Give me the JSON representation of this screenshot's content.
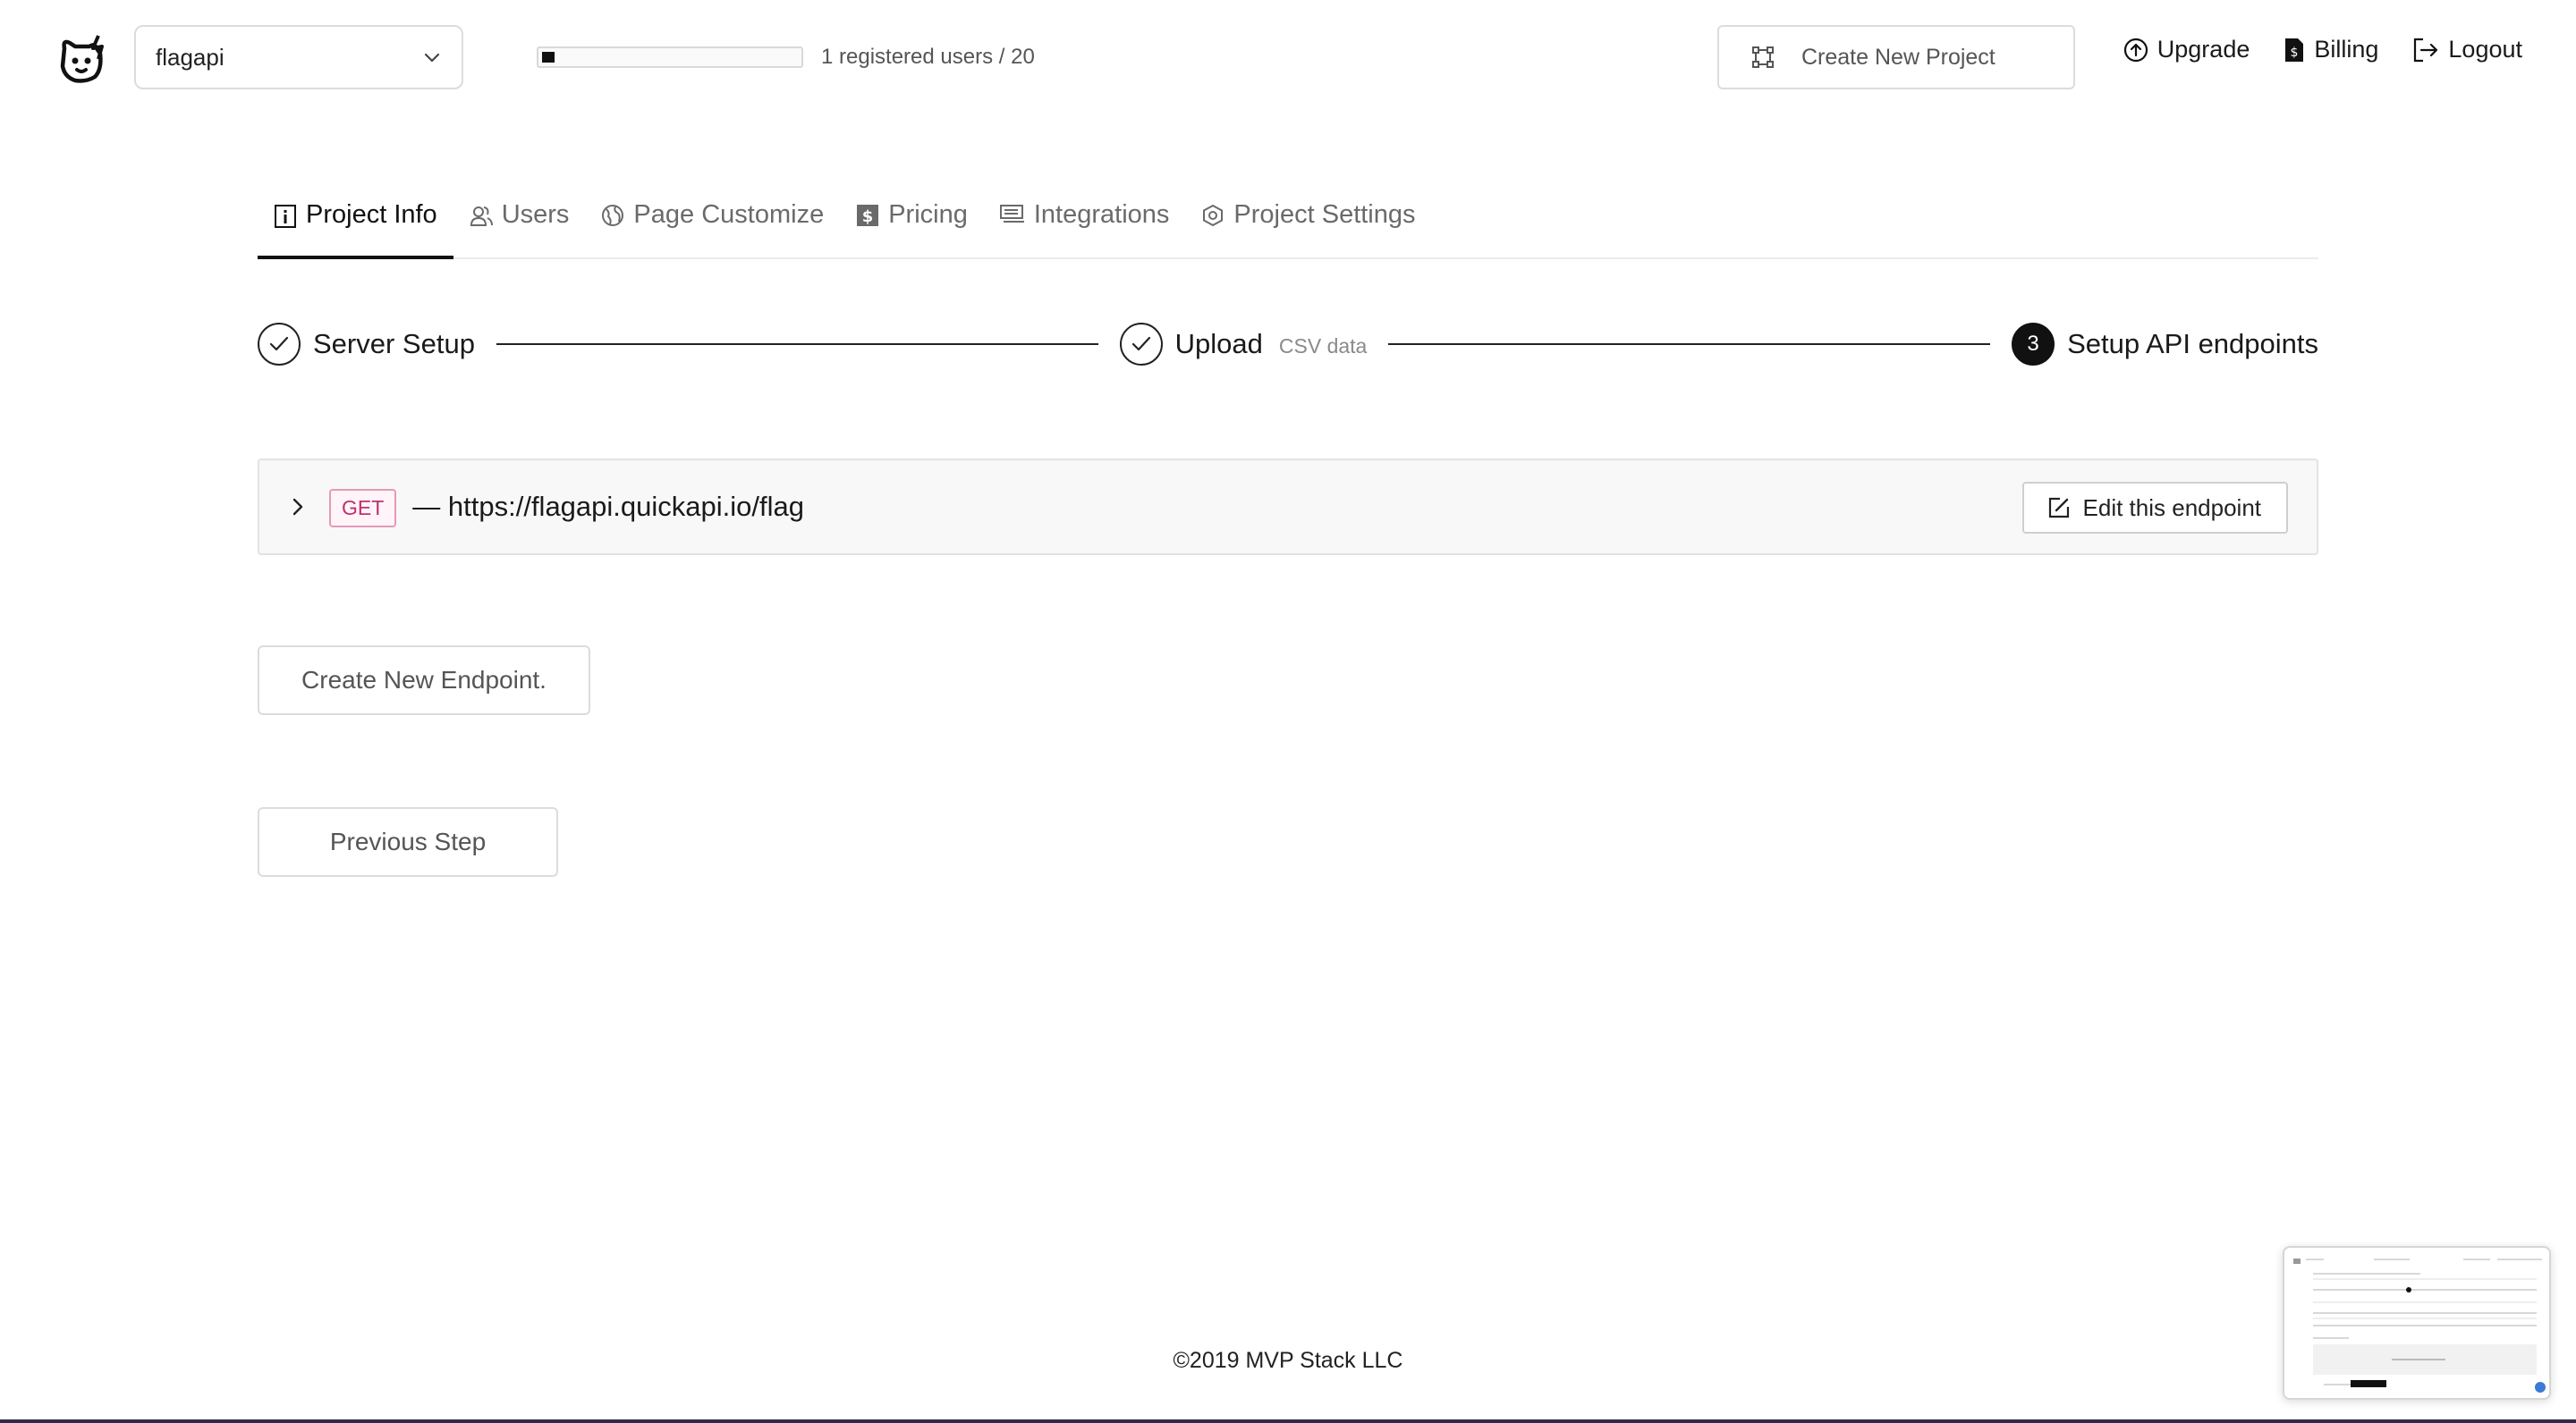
{
  "header": {
    "logo_icon": "dog-face-logo-icon",
    "project_select": {
      "value": "flagapi"
    },
    "usage": {
      "text": "1 registered users / 20",
      "fraction": 0.05
    },
    "create_project_label": "Create New Project",
    "links": [
      {
        "label": "Upgrade",
        "icon": "arrow-up-circle-icon"
      },
      {
        "label": "Billing",
        "icon": "dollar-document-icon"
      },
      {
        "label": "Logout",
        "icon": "logout-icon"
      }
    ]
  },
  "tabs": [
    {
      "label": "Project Info",
      "icon": "info-icon",
      "active": true
    },
    {
      "label": "Users",
      "icon": "users-icon",
      "active": false
    },
    {
      "label": "Page Customize",
      "icon": "globe-icon",
      "active": false
    },
    {
      "label": "Pricing",
      "icon": "dollar-icon",
      "active": false
    },
    {
      "label": "Integrations",
      "icon": "integrations-icon",
      "active": false
    },
    {
      "label": "Project Settings",
      "icon": "settings-hexagon-icon",
      "active": false
    }
  ],
  "stepper": {
    "steps": [
      {
        "title": "Server Setup",
        "desc": "",
        "state": "done"
      },
      {
        "title": "Upload",
        "desc": "CSV data",
        "state": "done"
      },
      {
        "title": "Setup API endpoints",
        "desc": "",
        "state": "current",
        "number": "3"
      }
    ]
  },
  "endpoint": {
    "method": "GET",
    "url": "— https://flagapi.quickapi.io/flag",
    "edit_label": "Edit this endpoint"
  },
  "actions": {
    "create_endpoint": "Create New Endpoint.",
    "previous_step": "Previous Step"
  },
  "footer": {
    "copyright": "©2019 MVP Stack LLC"
  },
  "colors": {
    "accent": "#111111",
    "method_badge": "#c0306f",
    "endpoint_bg": "#f8f8f8"
  }
}
